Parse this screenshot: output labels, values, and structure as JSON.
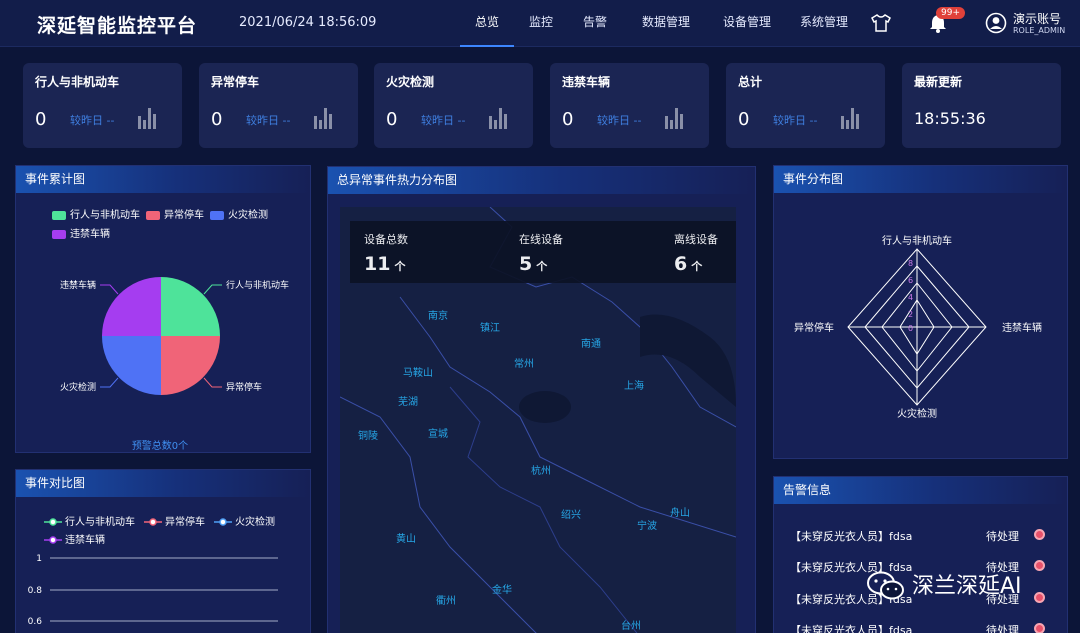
{
  "header": {
    "brand": "深延智能监控平台",
    "datetime": "2021/06/24 18:56:09",
    "nav": [
      "总览",
      "监控",
      "告警",
      "数据管理",
      "设备管理",
      "系统管理"
    ],
    "active_nav": "总览",
    "badge": "99+",
    "account_name": "演示账号",
    "account_role": "ROLE_ADMIN"
  },
  "cards": [
    {
      "title": "行人与非机动车",
      "value": "0",
      "compare": "较昨日 --"
    },
    {
      "title": "异常停车",
      "value": "0",
      "compare": "较昨日 --"
    },
    {
      "title": "火灾检测",
      "value": "0",
      "compare": "较昨日 --"
    },
    {
      "title": "违禁车辆",
      "value": "0",
      "compare": "较昨日 --"
    },
    {
      "title": "总计",
      "value": "0",
      "compare": "较昨日 --"
    },
    {
      "title": "最新更新",
      "time": "18:55:36"
    }
  ],
  "pie_panel": {
    "title": "事件累计图",
    "legend": [
      "行人与非机动车",
      "异常停车",
      "火灾检测",
      "违禁车辆"
    ],
    "footer": "预警总数0个"
  },
  "compare_panel": {
    "title": "事件对比图",
    "legend": [
      "行人与非机动车",
      "异常停车",
      "火灾检测",
      "违禁车辆"
    ]
  },
  "map_panel": {
    "title": "总异常事件热力分布图",
    "stats": [
      {
        "label": "设备总数",
        "value": "11",
        "unit": "个"
      },
      {
        "label": "在线设备",
        "value": "5",
        "unit": "个"
      },
      {
        "label": "离线设备",
        "value": "6",
        "unit": "个"
      }
    ],
    "cities": [
      "南京",
      "镇江",
      "常州",
      "南通",
      "马鞍山",
      "上海",
      "芜湖",
      "铜陵",
      "宣城",
      "杭州",
      "绍兴",
      "宁波",
      "舟山",
      "黄山",
      "金华",
      "衢州",
      "台州"
    ]
  },
  "radar_panel": {
    "title": "事件分布图",
    "axes": [
      "行人与非机动车",
      "违禁车辆",
      "火灾检测",
      "异常停车"
    ],
    "ticks": [
      "0",
      "2",
      "4",
      "6",
      "8"
    ]
  },
  "alarm_panel": {
    "title": "告警信息",
    "rows": [
      {
        "text": "【未穿反光衣人员】fdsa",
        "status": "待处理"
      },
      {
        "text": "【未穿反光衣人员】fdsa",
        "status": "待处理"
      },
      {
        "text": "【未穿反光衣人员】fdsa",
        "status": "待处理"
      },
      {
        "text": "【未穿反光衣人员】fdsa",
        "status": "待处理"
      }
    ]
  },
  "watermark": "深兰深延AI",
  "chart_data": [
    {
      "type": "pie",
      "title": "事件累计图",
      "categories": [
        "行人与非机动车",
        "异常停车",
        "火灾检测",
        "违禁车辆"
      ],
      "values": [
        0,
        0,
        0,
        0
      ],
      "colors": [
        "#4ee39a",
        "#f06478",
        "#4f72f5",
        "#a53df0"
      ]
    },
    {
      "type": "radar",
      "title": "事件分布图",
      "categories": [
        "行人与非机动车",
        "违禁车辆",
        "火灾检测",
        "异常停车"
      ],
      "values": [
        0,
        0,
        0,
        0
      ],
      "range": [
        0,
        8
      ]
    },
    {
      "type": "line",
      "title": "事件对比图",
      "series": [
        {
          "name": "行人与非机动车",
          "values": []
        },
        {
          "name": "异常停车",
          "values": []
        },
        {
          "name": "火灾检测",
          "values": []
        },
        {
          "name": "违禁车辆",
          "values": []
        }
      ],
      "y_ticks": [
        "1",
        "0.8",
        "0.6"
      ],
      "colors": [
        "#4ee39a",
        "#f06478",
        "#4f9ff5",
        "#a53df0"
      ]
    }
  ],
  "colors": {
    "background": "#0c1538",
    "panel": "#162056",
    "accent": "#3d86ff",
    "alert": "#e0413a"
  }
}
